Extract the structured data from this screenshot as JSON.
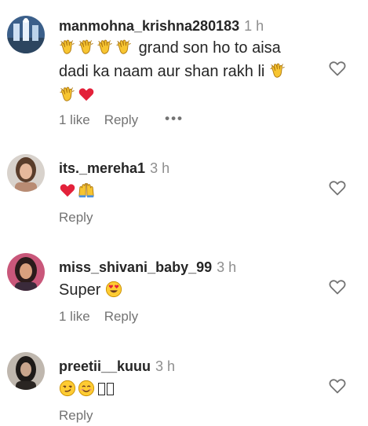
{
  "comments": [
    {
      "username": "manmohna_krishna280183",
      "time": "1 h",
      "line1_text": "grand son ho to aisa",
      "line2_text": "dadi ka naam aur shan rakh li",
      "likes": "1 like",
      "reply": "Reply",
      "more": "•••"
    },
    {
      "username": "its._mereha1",
      "time": "3 h",
      "reply": "Reply"
    },
    {
      "username": "miss_shivani_baby_99",
      "time": "3 h",
      "text": "Super",
      "likes": "1 like",
      "reply": "Reply"
    },
    {
      "username": "preetii__kuuu",
      "time": "3 h",
      "reply": "Reply"
    }
  ],
  "icons": {
    "like": "heart-outline-icon",
    "clap": "clapping-hands-emoji",
    "heart": "red-heart-emoji",
    "raised": "raising-hands-emoji",
    "heart_eyes": "heart-eyes-emoji",
    "smirk": "smirking-face-emoji",
    "smile": "smiling-face-emoji"
  },
  "colors": {
    "text": "#262626",
    "secondary": "#737373",
    "meta": "#8e8e8e",
    "heart_red": "#e0245e",
    "emoji_yellow": "#ffcc33"
  }
}
